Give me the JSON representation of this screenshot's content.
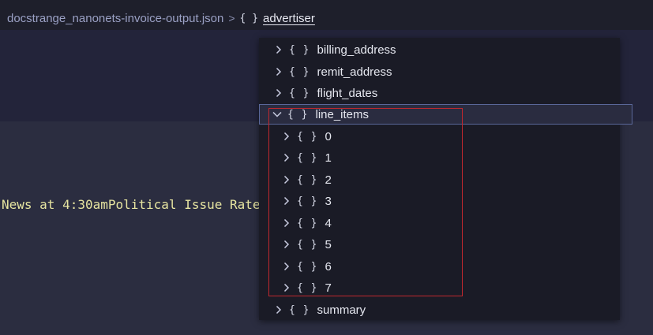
{
  "breadcrumb": {
    "file": "docstrange_nanonets-invoice-output.json",
    "separator": ">",
    "braces": "{ }",
    "current": "advertiser"
  },
  "editor": {
    "code_text": "News at 4:30amPolitical Issue Rate"
  },
  "outline": {
    "items": [
      {
        "label": "billing_address",
        "braces": "{ }",
        "state": "collapsed"
      },
      {
        "label": "remit_address",
        "braces": "{ }",
        "state": "collapsed"
      },
      {
        "label": "flight_dates",
        "braces": "{ }",
        "state": "collapsed"
      },
      {
        "label": "line_items",
        "braces": "{ }",
        "state": "expanded"
      },
      {
        "label": "0",
        "braces": "{ }",
        "state": "collapsed"
      },
      {
        "label": "1",
        "braces": "{ }",
        "state": "collapsed"
      },
      {
        "label": "2",
        "braces": "{ }",
        "state": "collapsed"
      },
      {
        "label": "3",
        "braces": "{ }",
        "state": "collapsed"
      },
      {
        "label": "4",
        "braces": "{ }",
        "state": "collapsed"
      },
      {
        "label": "5",
        "braces": "{ }",
        "state": "collapsed"
      },
      {
        "label": "6",
        "braces": "{ }",
        "state": "collapsed"
      },
      {
        "label": "7",
        "braces": "{ }",
        "state": "collapsed"
      },
      {
        "label": "summary",
        "braces": "{ }",
        "state": "collapsed"
      }
    ]
  },
  "colors": {
    "highlight_border": "#c0282e",
    "selected_outline": "#5a6799",
    "code_text": "#e6e4a0"
  }
}
